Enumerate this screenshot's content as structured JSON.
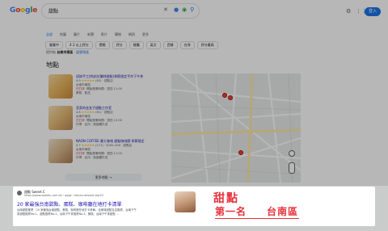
{
  "header": {
    "logo": [
      "G",
      "o",
      "o",
      "g",
      "l",
      "e"
    ],
    "query": "甜點",
    "login_label": "登入"
  },
  "tabs": [
    "全部",
    "地圖",
    "圖片",
    "新聞",
    "影片",
    "購物",
    "網頁",
    "更多"
  ],
  "chips": [
    "營業中",
    "4.1 以上評分",
    "價格",
    "評分",
    "餐廳",
    "英文",
    "西餐",
    "台灣",
    "評分最高"
  ],
  "location": {
    "prefix": "提供給",
    "place": "台南市東區",
    "link": "變更地區"
  },
  "maps_heading": "地點",
  "places": [
    {
      "name": "初妳手工烘焙坊(獨特甜點)季節限定手作下午茶",
      "rating": "4.9",
      "reviews": "(83)",
      "type": "甜點店",
      "area": "台南市東區",
      "status": "已打烊",
      "hours": "·開始營業時間：週四 11:00",
      "extra": "蛋糕 · 飲品"
    },
    {
      "name": "吾家的金女子甜點工作室",
      "rating": "4.6",
      "reviews": "(61)",
      "type": "甜點店",
      "area": "台南市東區",
      "status": "已打烊",
      "hours": "·開始營業時間：週四 12:00",
      "extra": "外帶 · 店內 · 無接觸外送"
    },
    {
      "name": "NAON COFFEE 娜ㄤ咖啡 甜點咖啡館·季節限定",
      "rating": "4.7",
      "reviews": "(171)",
      "type": "$200–400 · 甜點店",
      "area": "台南市東區",
      "status": "已打烊",
      "hours": "·開始營業時間：週四 11:00",
      "extra": "外帶 · 店內 · 無接觸外送"
    }
  ],
  "more_places_label": "更多地點  →",
  "result": {
    "site": "甜點 Sweet.C",
    "url": "https://www.sweetc.com.tw › page › tainan-dessert-top20",
    "title": "20 家最強台南甜點、蛋糕、咖啡廳在地打卡清單",
    "snippet": "台南甜點推薦｜20 家最強台南甜點、蛋糕、咖啡廳在地打卡清單，含美味甜點名店推薦、台南下午茶甜點推薦No.1、甜點推薦No.2，台南下午茶推薦No.3、蛋糕、台南下午茶甜點 ..."
  },
  "overlay": {
    "line1": "甜點",
    "line2a": "第一名",
    "line2b": "台南區"
  }
}
